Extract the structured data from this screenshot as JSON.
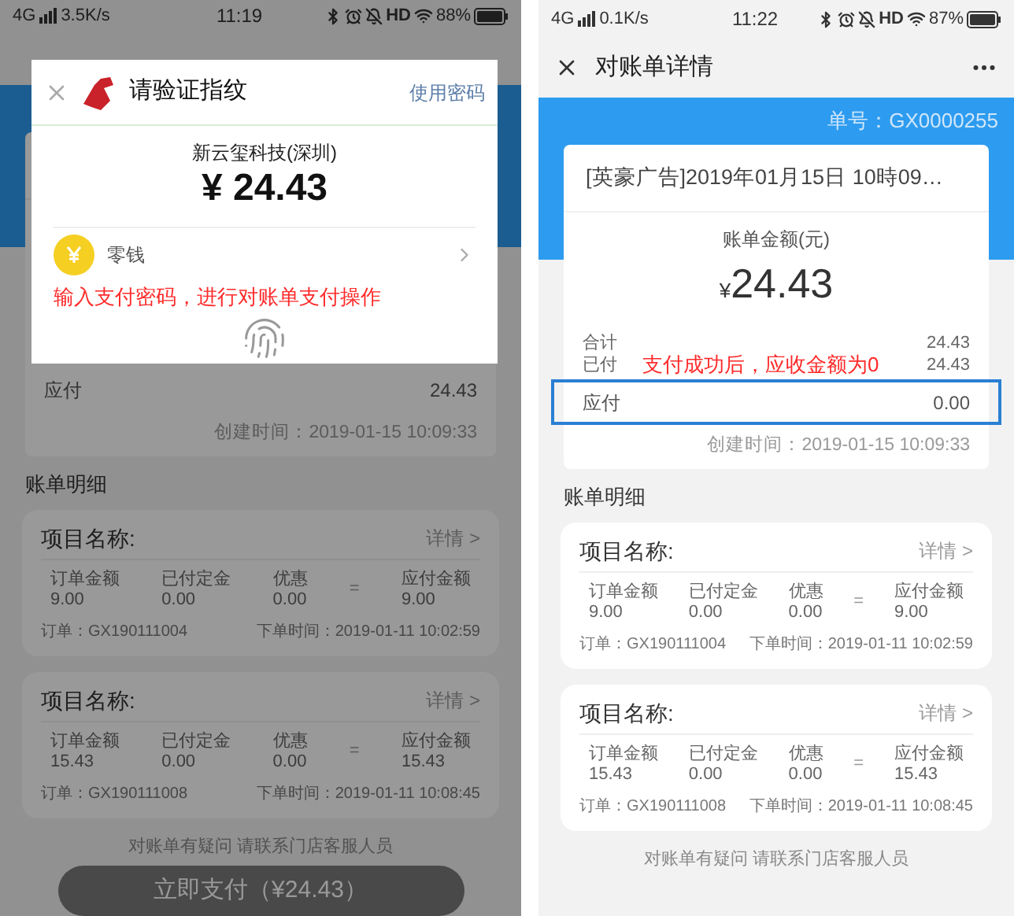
{
  "screens": [
    {
      "status_bar": {
        "network": "4G",
        "speed": "3.5K/s",
        "time": "11:19",
        "hd": "HD",
        "battery": "88%"
      },
      "dimmed": true,
      "due": {
        "label": "应付",
        "value": "24.43",
        "highlighted": false
      },
      "created": "创建时间：2019-01-15 10:09:33",
      "section_title": "账单明细",
      "items": [
        {
          "title": "项目名称:",
          "link": "详情 >",
          "fields": [
            {
              "label": "订单金额",
              "value": "9.00"
            },
            {
              "label": "已付定金",
              "value": "0.00"
            },
            {
              "label": "优惠",
              "value": "0.00"
            }
          ],
          "equals": "=",
          "result": {
            "label": "应付金额",
            "value": "9.00"
          },
          "order": "订单：GX190111004",
          "time": "下单时间：2019-01-11 10:02:59"
        },
        {
          "title": "项目名称:",
          "link": "详情 >",
          "fields": [
            {
              "label": "订单金额",
              "value": "15.43"
            },
            {
              "label": "已付定金",
              "value": "0.00"
            },
            {
              "label": "优惠",
              "value": "0.00"
            }
          ],
          "equals": "=",
          "result": {
            "label": "应付金额",
            "value": "15.43"
          },
          "order": "订单：GX190111008",
          "time": "下单时间：2019-01-11 10:08:45"
        }
      ],
      "footer": "对账单有疑问 请联系门店客服人员",
      "pay_button": "立即支付（¥24.43）",
      "dialog": {
        "title": "请验证指纹",
        "link": "使用密码",
        "merchant": "新云玺科技(深圳)",
        "amount": "¥ 24.43",
        "method": "零钱",
        "annotation": "输入支付密码，进行对账单支付操作"
      }
    },
    {
      "status_bar": {
        "network": "4G",
        "speed": "0.1K/s",
        "time": "11:22",
        "hd": "HD",
        "battery": "87%"
      },
      "dimmed": false,
      "title": "对账单详情",
      "order_no": "单号：GX0000255",
      "ticket_title": "[英豪广告]2019年01月15日 10時09…",
      "amount_label": "账单金额(元)",
      "currency": "¥",
      "amount": "24.43",
      "totals": [
        {
          "label": "合计",
          "value": "24.43"
        },
        {
          "label": "已付",
          "value": "24.43",
          "annotation": "支付成功后，应收金额为0"
        }
      ],
      "due": {
        "label": "应付",
        "value": "0.00",
        "highlighted": true
      },
      "created": "创建时间：2019-01-15 10:09:33",
      "section_title": "账单明细",
      "items": [
        {
          "title": "项目名称:",
          "link": "详情 >",
          "fields": [
            {
              "label": "订单金额",
              "value": "9.00"
            },
            {
              "label": "已付定金",
              "value": "0.00"
            },
            {
              "label": "优惠",
              "value": "0.00"
            }
          ],
          "equals": "=",
          "result": {
            "label": "应付金额",
            "value": "9.00"
          },
          "order": "订单：GX190111004",
          "time": "下单时间：2019-01-11 10:02:59"
        },
        {
          "title": "项目名称:",
          "link": "详情 >",
          "fields": [
            {
              "label": "订单金额",
              "value": "15.43"
            },
            {
              "label": "已付定金",
              "value": "0.00"
            },
            {
              "label": "优惠",
              "value": "0.00"
            }
          ],
          "equals": "=",
          "result": {
            "label": "应付金额",
            "value": "15.43"
          },
          "order": "订单：GX190111008",
          "time": "下单时间：2019-01-11 10:08:45"
        }
      ],
      "footer": "对账单有疑问 请联系门店客服人员"
    }
  ]
}
